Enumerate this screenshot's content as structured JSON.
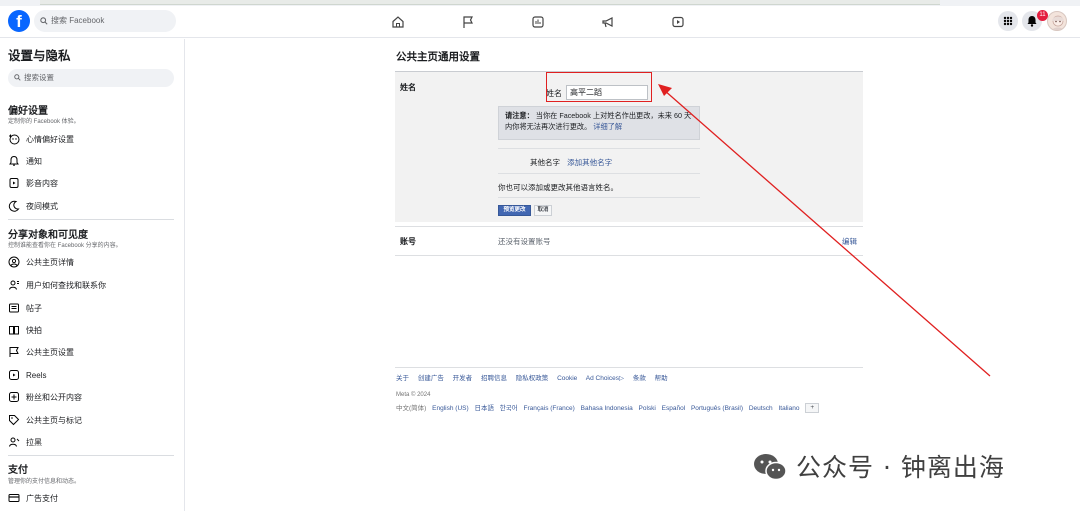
{
  "topbar": {
    "logo_text": "f",
    "search_placeholder": "搜索 Facebook",
    "notification_count": "11"
  },
  "sidebar": {
    "title": "设置与隐私",
    "search_placeholder": "搜索设置",
    "sections": [
      {
        "heading": "偏好设置",
        "subtitle": "定制你的 Facebook 体验。",
        "items": [
          "心情偏好设置",
          "通知",
          "影音内容",
          "夜间模式"
        ]
      },
      {
        "heading": "分享对象和可见度",
        "subtitle": "控制谁能查看你在 Facebook 分享的内容。",
        "items": [
          "公共主页详情",
          "用户如何查找和联系你",
          "帖子",
          "快拍",
          "公共主页设置",
          "Reels",
          "粉丝和公开内容",
          "公共主页与标记",
          "拉黑"
        ]
      },
      {
        "heading": "支付",
        "subtitle": "管理你的支付信息和动态。",
        "items": [
          "广告支付"
        ]
      }
    ]
  },
  "main": {
    "title": "公共主页通用设置",
    "name_label": "姓名",
    "name_field_label": "姓名",
    "name_value": "高平二蹈",
    "notice_bold": "请注意：",
    "notice_text": "当你在 Facebook 上对姓名作出更改，未来 60 天内你将无法再次进行更改。",
    "notice_link": "详细了解",
    "other_names_label": "其他名字",
    "other_names_link": "添加其他名字",
    "add_language_text": "你也可以添加或更改其他语言姓名。",
    "preview_button": "预览更改",
    "cancel_button": "取消",
    "account_label": "账号",
    "account_value": "还没有设置账号",
    "account_edit": "编辑"
  },
  "footer": {
    "links": [
      "关于",
      "创建广告",
      "开发者",
      "招聘信息",
      "隐私权政策",
      "Cookie",
      "Ad Choices▷",
      "条款",
      "帮助"
    ],
    "meta": "Meta © 2024",
    "current_language": "中文(简体)",
    "languages": [
      "English (US)",
      "日本語",
      "한국어",
      "Français (France)",
      "Bahasa Indonesia",
      "Polski",
      "Español",
      "Português (Brasil)",
      "Deutsch",
      "Italiano"
    ],
    "plus": "+"
  },
  "watermark": {
    "text": "公众号 · 钟离出海"
  },
  "colors": {
    "brand": "#0866ff",
    "link": "#385898",
    "annotation": "#e02020"
  }
}
